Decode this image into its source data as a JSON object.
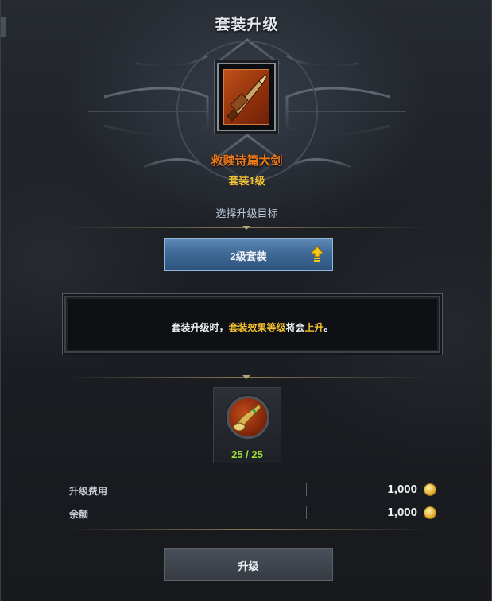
{
  "window": {
    "title": "套装升级"
  },
  "item": {
    "name": "救赎诗篇大剑",
    "level": "套装1级",
    "icon": "greatsword-icon"
  },
  "target": {
    "label": "选择升级目标",
    "selected": "2级套装",
    "icon": "upgrade-arrow-icon"
  },
  "info": {
    "part1": "套装升级时，",
    "part2": "套装效果等级",
    "part3": "将会",
    "part4": "上升",
    "part5": "。"
  },
  "material": {
    "icon": "horn-icon",
    "count": "25 / 25"
  },
  "cost": [
    {
      "label": "升级费用",
      "value": "1,000",
      "icon": "gold-coin-icon"
    },
    {
      "label": "余额",
      "value": "1,000",
      "icon": "gold-coin-icon"
    }
  ],
  "actions": {
    "upgrade": "升级"
  },
  "colors": {
    "item_name": "#f07a18",
    "item_level": "#f2c230",
    "highlight": "#f2c230",
    "material_count": "#9ee036",
    "target_button": "#3f6a97"
  }
}
